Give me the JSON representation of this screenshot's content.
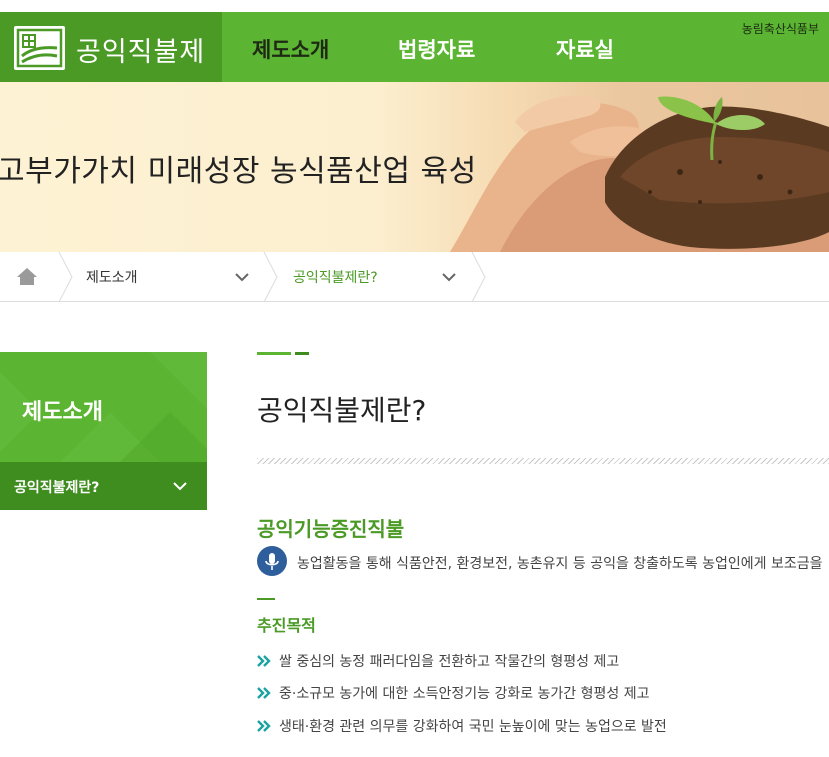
{
  "header": {
    "logo_text": "공익직불제",
    "ministry": "농림축산식품부",
    "nav": [
      "제도소개",
      "법령자료",
      "자료실"
    ]
  },
  "hero": {
    "title": "고부가가치 미래성장 농식품산업 육성"
  },
  "breadcrumb": {
    "items": [
      "제도소개",
      "공익직불제란?"
    ]
  },
  "sidebar": {
    "title": "제도소개",
    "sub_item": "공익직불제란?"
  },
  "content": {
    "page_title": "공익직불제란?",
    "section_title": "공익기능증진직불",
    "section_desc": "농업활동을 통해 식품안전, 환경보전, 농촌유지 등 공익을 창출하도록 농업인에게 보조금을",
    "purpose_title": "추진목적",
    "purposes": [
      "쌀 중심의 농정 패러다임을 전환하고 작물간의 형평성 제고",
      "중·소규모 농가에 대한 소득안정기능 강화로 농가간 형평성 제고",
      "생태·환경 관련 의무를 강화하여 국민 눈높이에 맞는 농업으로 발전"
    ]
  },
  "colors": {
    "brand_green": "#5bb532",
    "dark_green": "#3f8c1f",
    "mic_blue": "#2e5f9c",
    "arrow_teal": "#1aa3a0"
  }
}
